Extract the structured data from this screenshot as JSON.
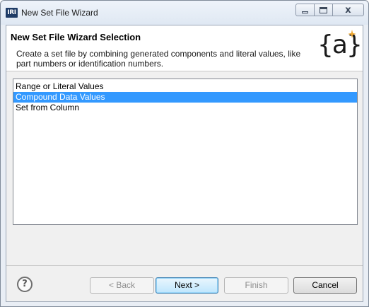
{
  "window": {
    "title": "New Set File Wizard",
    "app_icon_text": "IRI",
    "close_glyph": "x"
  },
  "banner": {
    "title": "New Set File Wizard Selection",
    "description": "Create a set file by combining generated components and literal values, like part numbers or identification numbers.",
    "logo_text": "{a}",
    "logo_icon": "wizard-logo-icon"
  },
  "list": {
    "items": [
      {
        "label": "Range or Literal Values",
        "selected": false
      },
      {
        "label": "Compound Data Values",
        "selected": true
      },
      {
        "label": "Set from Column",
        "selected": false
      }
    ]
  },
  "footer": {
    "help_glyph": "?",
    "back_label": "< Back",
    "next_label": "Next >",
    "finish_label": "Finish",
    "cancel_label": "Cancel"
  },
  "colors": {
    "selection": "#3399ff",
    "app_icon_bg": "#1e3b66",
    "logo_spark": "#f0a830"
  }
}
